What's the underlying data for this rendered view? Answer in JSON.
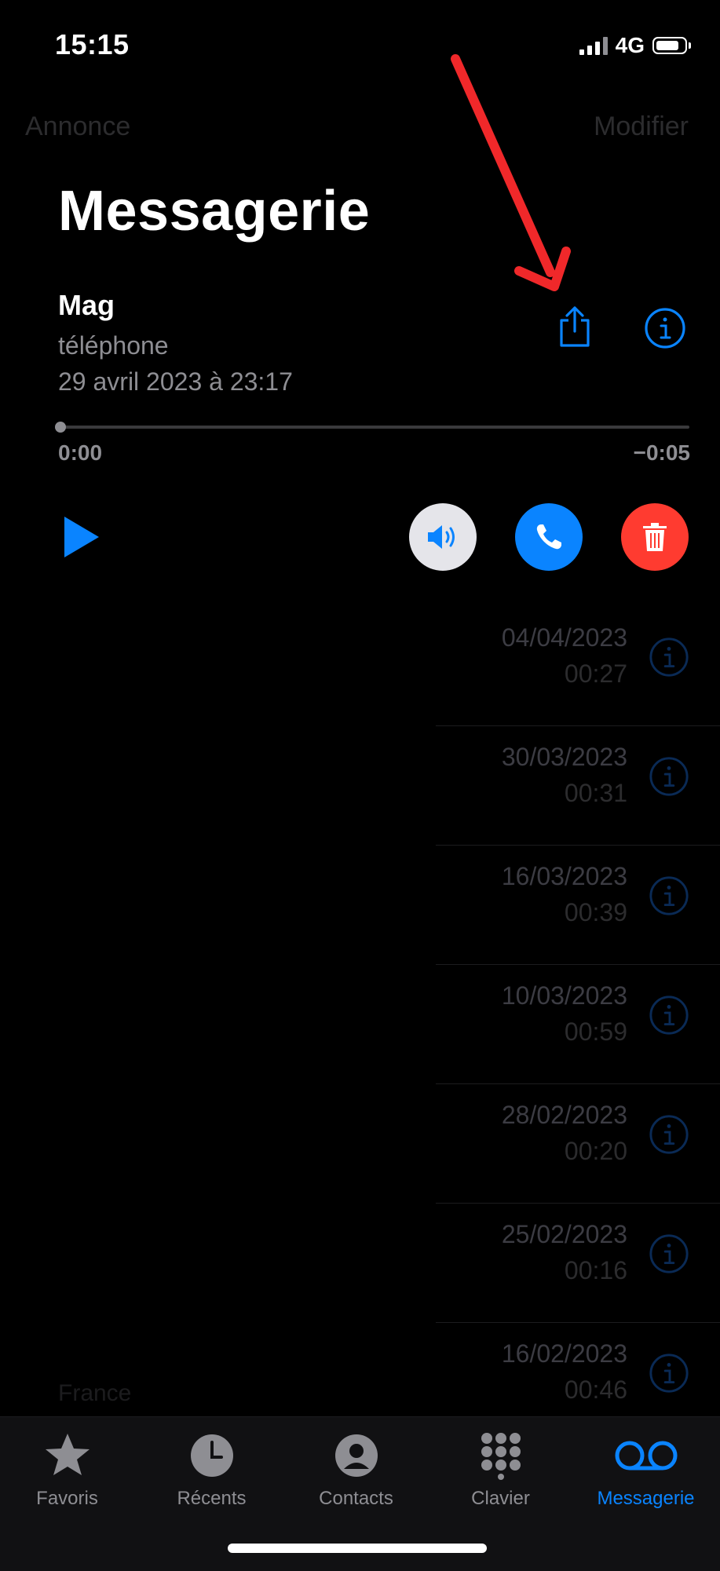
{
  "status_bar": {
    "time": "15:15",
    "network": "4G",
    "battery_level": 0.7
  },
  "nav": {
    "left": "Annonce",
    "right": "Modifier"
  },
  "title": "Messagerie",
  "selected": {
    "caller": "Mag",
    "type": "téléphone",
    "datetime": "29 avril 2023 à 23:17",
    "elapsed": "0:00",
    "remaining": "−0:05",
    "progress": 0
  },
  "list": [
    {
      "date": "04/04/2023",
      "duration": "00:27"
    },
    {
      "date": "30/03/2023",
      "duration": "00:31"
    },
    {
      "date": "16/03/2023",
      "duration": "00:39"
    },
    {
      "date": "10/03/2023",
      "duration": "00:59"
    },
    {
      "date": "28/02/2023",
      "duration": "00:20"
    },
    {
      "date": "25/02/2023",
      "duration": "00:16"
    },
    {
      "date": "16/02/2023",
      "duration": "00:46"
    }
  ],
  "ghost_text": "France",
  "tabs": [
    {
      "label": "Favoris",
      "icon": "star-icon"
    },
    {
      "label": "Récents",
      "icon": "clock-icon"
    },
    {
      "label": "Contacts",
      "icon": "person-icon"
    },
    {
      "label": "Clavier",
      "icon": "keypad-icon"
    },
    {
      "label": "Messagerie",
      "icon": "voicemail-icon",
      "active": true
    }
  ],
  "colors": {
    "accent": "#0a84ff",
    "delete": "#ff3b30",
    "annotation_arrow": "#f0282a"
  }
}
